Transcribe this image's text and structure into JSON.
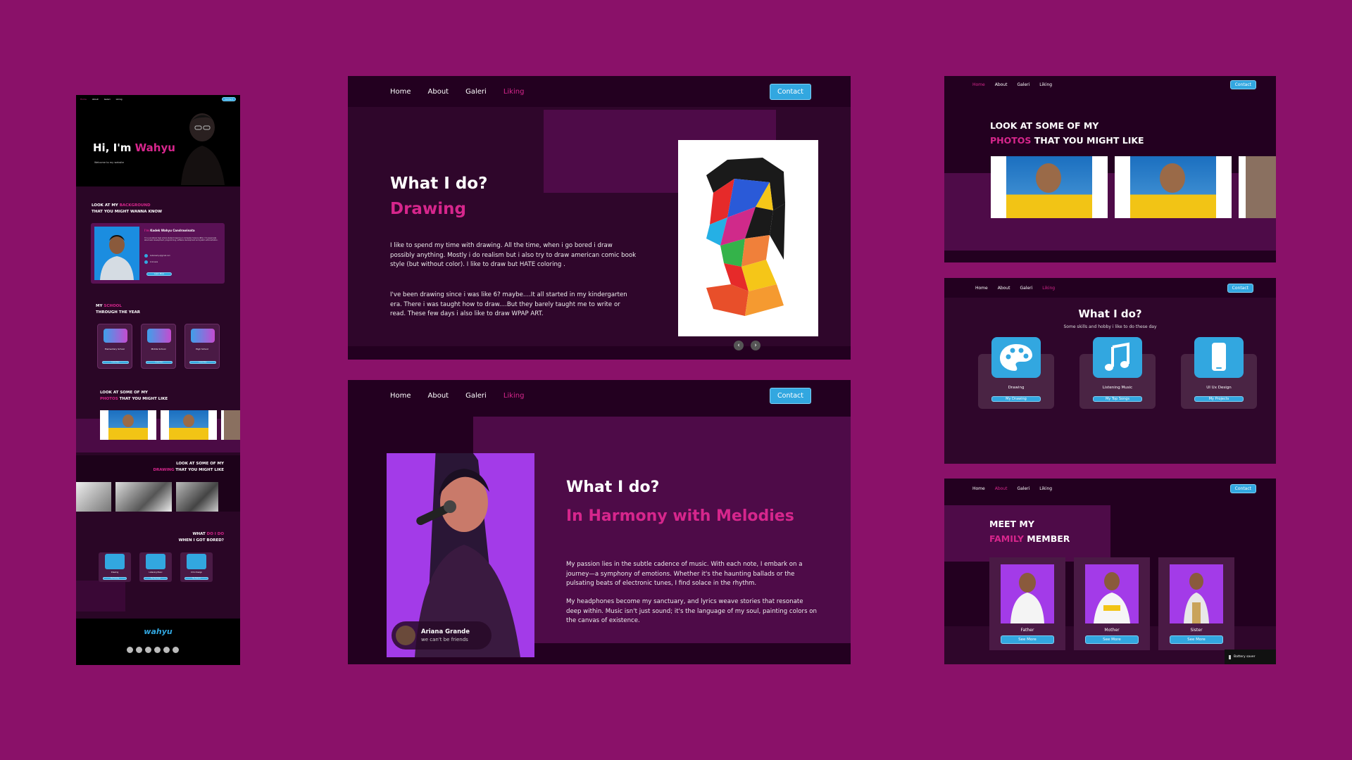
{
  "nav": {
    "home": "Home",
    "about": "About",
    "galeri": "Galeri",
    "liking": "Liking",
    "contact": "Contact"
  },
  "mobile": {
    "hero_title_a": "Hi, I'm ",
    "hero_title_b": "Wahyu",
    "hero_sub": "Welcome to my website",
    "bg_a": "LOOK AT MY ",
    "bg_b": "BACKGROUND",
    "bg_c": "THAT YOU MIGHT WANNA KNOW",
    "profile_name_a": "I'm ",
    "profile_name_b": "Kadek Wahyu Candrawinata",
    "profile_text": "I'm a vocational high school student majoring in Computer Science (RPL). I'm passionate about web development, programming, software development and system administration.",
    "contact_1": "kadekwahyu@gmail.com",
    "contact_2": "Indonesia",
    "profile_btn": "Learn More",
    "school_a": "MY ",
    "school_b": "SCHOOL",
    "school_c": "THROUGH THE YEAR",
    "schools": [
      {
        "name": "Elementary School",
        "btn": "Learn More"
      },
      {
        "name": "Middle School",
        "btn": "Learn More"
      },
      {
        "name": "High School",
        "btn": "Learn More"
      }
    ],
    "photos_a": "LOOK AT SOME OF MY",
    "photos_b": "PHOTOS",
    "photos_c": " THAT YOU MIGHT LIKE",
    "drawing_a": "LOOK AT SOME OF MY",
    "drawing_b": "DRAWING",
    "drawing_c": " THAT YOU MIGHT LIKE",
    "bored_a": "WHAT ",
    "bored_b": "DO I DO",
    "bored_c": "WHEN I GOT BORED?",
    "skills": [
      {
        "label": "Drawing",
        "btn": "My Drawing"
      },
      {
        "label": "Listening Music",
        "btn": "My Top Songs"
      },
      {
        "label": "UI Ux Design",
        "btn": "My Projects"
      }
    ],
    "logo": "wahyu"
  },
  "drawing": {
    "title": "What I do?",
    "subtitle": "Drawing",
    "p1": "I like to spend my time with drawing. All the time, when i go bored i draw possibly anything. Mostly i do realism but i also try to draw american comic book style (but without color). I like to draw but HATE coloring .",
    "p2": "I've been drawing since i was like 6? maybe....It all started in my kindergarten era. There i was taught  how to draw....But they barely taught me to write or read.  These few days i also like to draw WPAP ART."
  },
  "music": {
    "title": "What I do?",
    "subtitle": "In Harmony with Melodies",
    "p1": "My passion lies in the subtle cadence of music. With each note, I embark on a journey—a symphony of emotions. Whether it's the haunting ballads or the pulsating beats of electronic tunes, I find solace in the rhythm.",
    "p2": "My headphones become my sanctuary, and lyrics weave stories that resonate deep within. Music isn't just sound; it's the language of my soul, painting colors on the canvas of existence.",
    "card_name": "Ariana Grande",
    "card_song": "we can't be friends"
  },
  "photos": {
    "title_a": "LOOK AT SOME OF MY",
    "title_b": "PHOTOS",
    "title_c": " THAT YOU MIGHT LIKE"
  },
  "whatido": {
    "title": "What I do?",
    "sub": "Some skills and hobby i like to do these day",
    "skills": [
      {
        "label": "Drawing",
        "btn": "My Drawing"
      },
      {
        "label": "Listening Music",
        "btn": "My Top Songs"
      },
      {
        "label": "UI Ux Design",
        "btn": "My Projects"
      }
    ]
  },
  "family": {
    "title_a": "MEET MY",
    "title_b": "FAMILY",
    "title_c": " MEMBER",
    "members": [
      {
        "role": "Father",
        "btn": "See More"
      },
      {
        "role": "Mother",
        "btn": "See More"
      },
      {
        "role": "Sister",
        "btn": "See More"
      }
    ],
    "toast": "Battery saver"
  },
  "colors": {
    "bg": "#8a1169",
    "panel": "#230020",
    "accent": "#d6268c",
    "button": "#32a7e0",
    "block": "#4b0b45"
  }
}
